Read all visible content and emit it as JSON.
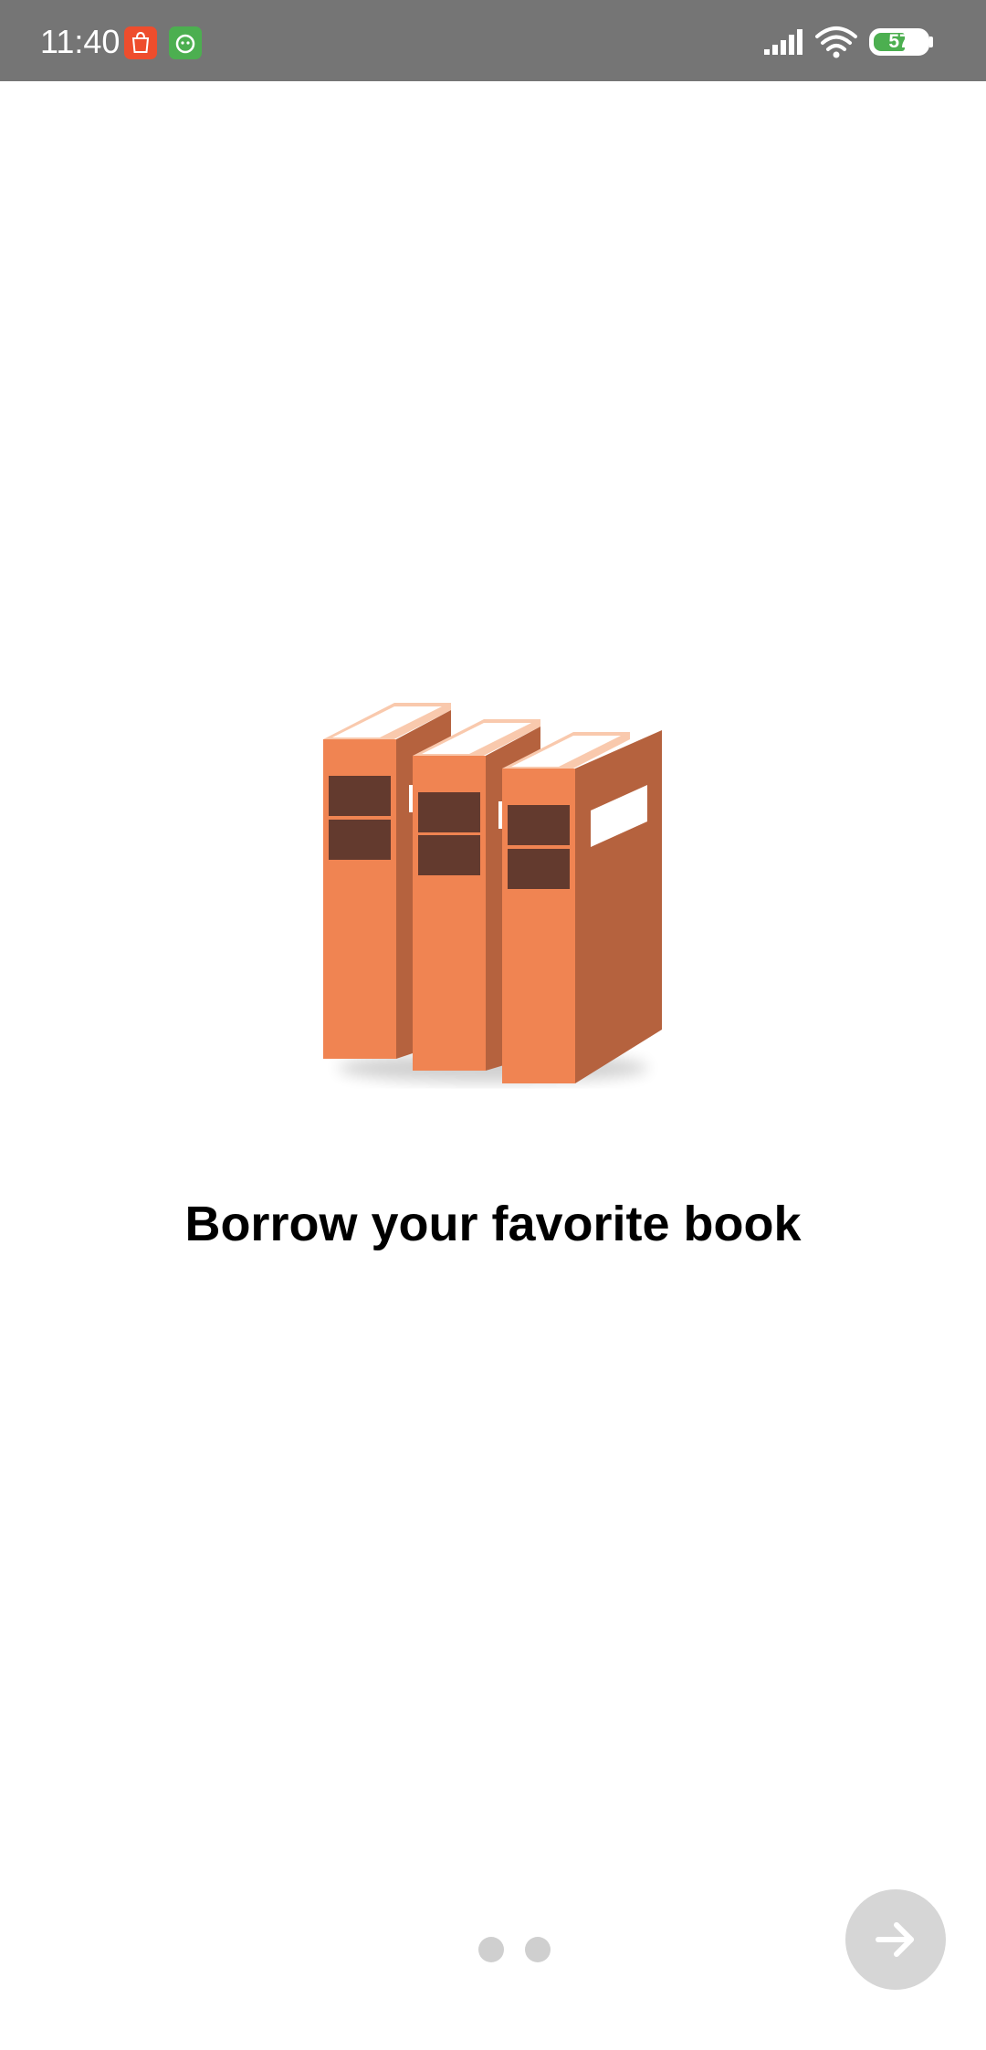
{
  "status_bar": {
    "time": "11:40",
    "battery_level": "57",
    "notification_icons": [
      "shopee-icon",
      "green-app-icon"
    ],
    "system_icons": [
      "signal-icon",
      "wifi-icon",
      "battery-icon"
    ]
  },
  "onboarding": {
    "illustration": "books-icon",
    "title": "Borrow your favorite book",
    "page_count": 2,
    "current_page": 1,
    "next_button_icon": "arrow-right-icon"
  },
  "colors": {
    "status_bar_bg": "#757575",
    "book_front": "#f08452",
    "book_side": "#b5623e",
    "book_label": "#633a2e",
    "dot": "#cfcfcf",
    "next_button_bg": "#d6d6d6",
    "battery": "#4caf50"
  }
}
